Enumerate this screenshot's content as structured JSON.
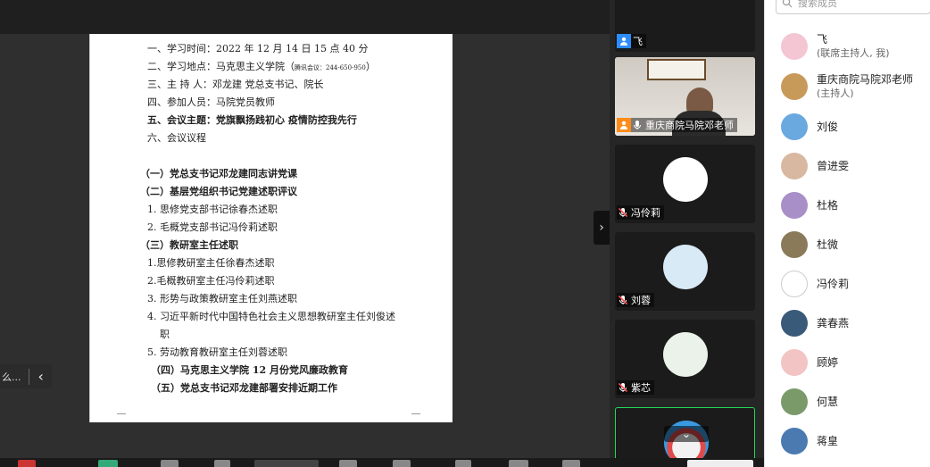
{
  "document": {
    "lines": [
      {
        "text": "一、学习时间：2022 年 12 月 14 日 15 点 40 分",
        "style": ""
      },
      {
        "text": "二、学习地点：马克思主义学院（",
        "style": "",
        "small": "腾讯会议：244-650-950",
        "tail": "）"
      },
      {
        "text": "三、主 持 人：邓龙建  党总支书记、院长",
        "style": ""
      },
      {
        "text": "四、参加人员：马院党员教师",
        "style": ""
      },
      {
        "text": "五、会议主题：党旗飘扬践初心  疫情防控我先行",
        "style": "b"
      },
      {
        "text": "六、会议议程",
        "style": ""
      },
      {
        "text": "（一）党总支书记邓龙建同志讲党课",
        "style": "b"
      },
      {
        "text": "（二）基层党组织书记党建述职评议",
        "style": "b"
      },
      {
        "text": "1. 思修党支部书记徐春杰述职",
        "style": ""
      },
      {
        "text": "2. 毛概党支部书记冯伶莉述职",
        "style": ""
      },
      {
        "text": "（三）教研室主任述职",
        "style": "b"
      },
      {
        "text": "1.思修教研室主任徐春杰述职",
        "style": ""
      },
      {
        "text": "2.毛概教研室主任冯伶莉述职",
        "style": ""
      },
      {
        "text": "3. 形势与政策教研室主任刘燕述职",
        "style": ""
      },
      {
        "text": "4. 习近平新时代中国特色社会主义思想教研室主任刘俊述",
        "style": ""
      },
      {
        "text": "职",
        "style": ""
      },
      {
        "text": "5. 劳动教育教研室主任刘蓉述职",
        "style": ""
      },
      {
        "text": "（四）马克思主义学院 12 月份党风廉政教育",
        "style": "b"
      },
      {
        "text": "（五）党总支书记邓龙建部署安排近期工作",
        "style": "b"
      }
    ]
  },
  "annotation": {
    "label": "么..."
  },
  "video_tiles": [
    {
      "name": "飞",
      "mic": "host"
    },
    {
      "name": "重庆商院马院邓老师",
      "mic": "on"
    },
    {
      "name": "冯伶莉",
      "mic": "muted"
    },
    {
      "name": "刘蓉",
      "mic": "muted"
    },
    {
      "name": "紫芯",
      "mic": "muted"
    },
    {
      "name": "",
      "mic": "none"
    }
  ],
  "participants_panel": {
    "search_placeholder": "搜索成员",
    "members": [
      {
        "name": "飞",
        "role": "(联席主持人, 我)",
        "avatar_color": "#f4c6d4"
      },
      {
        "name": "重庆商院马院邓老师",
        "role": "(主持人)",
        "avatar_color": "#c89a5a"
      },
      {
        "name": "刘俊",
        "role": "",
        "avatar_color": "#6aa8e0"
      },
      {
        "name": "曾进雯",
        "role": "",
        "avatar_color": "#d8b8a0"
      },
      {
        "name": "杜格",
        "role": "",
        "avatar_color": "#a88fc8"
      },
      {
        "name": "杜微",
        "role": "",
        "avatar_color": "#8a7a5a"
      },
      {
        "name": "冯伶莉",
        "role": "",
        "avatar_color": "#ffffff"
      },
      {
        "name": "龚春燕",
        "role": "",
        "avatar_color": "#3a5a7a"
      },
      {
        "name": "顾婷",
        "role": "",
        "avatar_color": "#f2c4c4"
      },
      {
        "name": "何慧",
        "role": "",
        "avatar_color": "#7a9a6a"
      },
      {
        "name": "蒋皇",
        "role": "",
        "avatar_color": "#4a7ab0"
      }
    ]
  },
  "colors": {
    "accent": "#2d8cff",
    "muted_mic": "#ff4d4f",
    "active_border": "#23d959"
  }
}
